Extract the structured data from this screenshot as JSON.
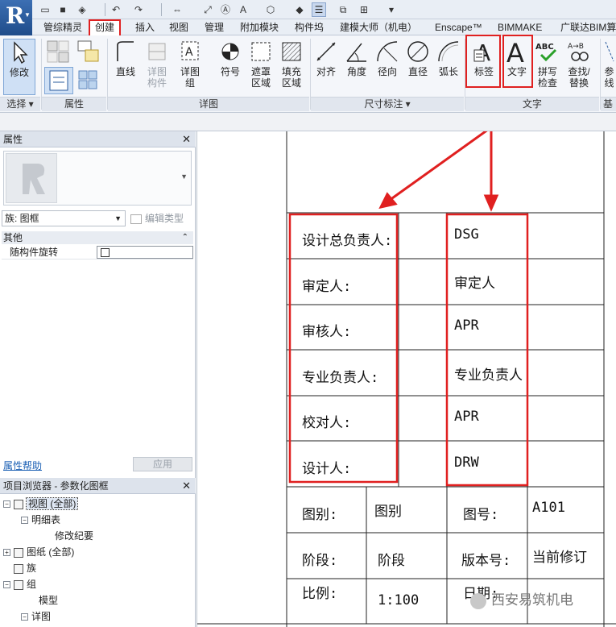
{
  "ribbon_tabs": [
    "管综精灵",
    "创建",
    "插入",
    "视图",
    "管理",
    "附加模块",
    "构件坞",
    "建模大师（机电）",
    "Enscape™",
    "BIMMAKE",
    "广联达BIM算"
  ],
  "ribbon": {
    "select": {
      "modify": "修改",
      "panel": "选择"
    },
    "properties_panel": "属性",
    "detail": {
      "line": "直线",
      "detail_component": "详图\n构件",
      "detail_group": "详图\n组",
      "panel": "详图"
    },
    "symbol": "符号",
    "masking_region": "遮罩\n区域",
    "filled_region": "填充\n区域",
    "dimension": {
      "aligned": "对齐",
      "angular": "角度",
      "radial": "径向",
      "diameter": "直径",
      "arc_length": "弧长",
      "panel": "尺寸标注"
    },
    "text": {
      "label": "标签",
      "text": "文字",
      "spell_check": "拼写\n检查",
      "find_replace": "查找/\n替换",
      "panel": "文字"
    },
    "reference": {
      "partial": "参\n线",
      "panel": "基"
    }
  },
  "properties": {
    "title": "属性",
    "family_label": "族: 图框",
    "edit_type": "编辑类型",
    "category_other": "其他",
    "param_name": "随构件旋转",
    "help_link": "属性帮助",
    "apply": "应用"
  },
  "browser": {
    "title": "项目浏览器 - 参数化图框",
    "items": [
      {
        "label": "视图 (全部)"
      },
      {
        "label": "明细表"
      },
      {
        "label": "修改纪要"
      },
      {
        "label": "图纸 (全部)"
      },
      {
        "label": "族"
      },
      {
        "label": "组"
      },
      {
        "label": "模型"
      },
      {
        "label": "详图"
      }
    ]
  },
  "titleblock": {
    "labels_left": [
      "设计总负责人:",
      "审定人:",
      "审核人:",
      "专业负责人:",
      "校对人:",
      "设计人:"
    ],
    "values_right": [
      "DSG",
      "审定人",
      "APR",
      "专业负责人",
      "APR",
      "DRW"
    ],
    "bottom": {
      "drawing_type_label": "图别:",
      "drawing_type_value": "图别",
      "drawing_no_label": "图号:",
      "drawing_no_value": "A101",
      "stage_label": "阶段:",
      "stage_value": "阶段",
      "version_label": "版本号:",
      "version_value": "当前修订",
      "scale_label": "比例:",
      "scale_value": "1:100",
      "date_label": "日期:"
    }
  },
  "watermark": "西安易筑机电",
  "colors": {
    "highlight": "#e02020",
    "ribbon_bg": "#f4f6fa",
    "app_blue": "#2b5c9e"
  }
}
